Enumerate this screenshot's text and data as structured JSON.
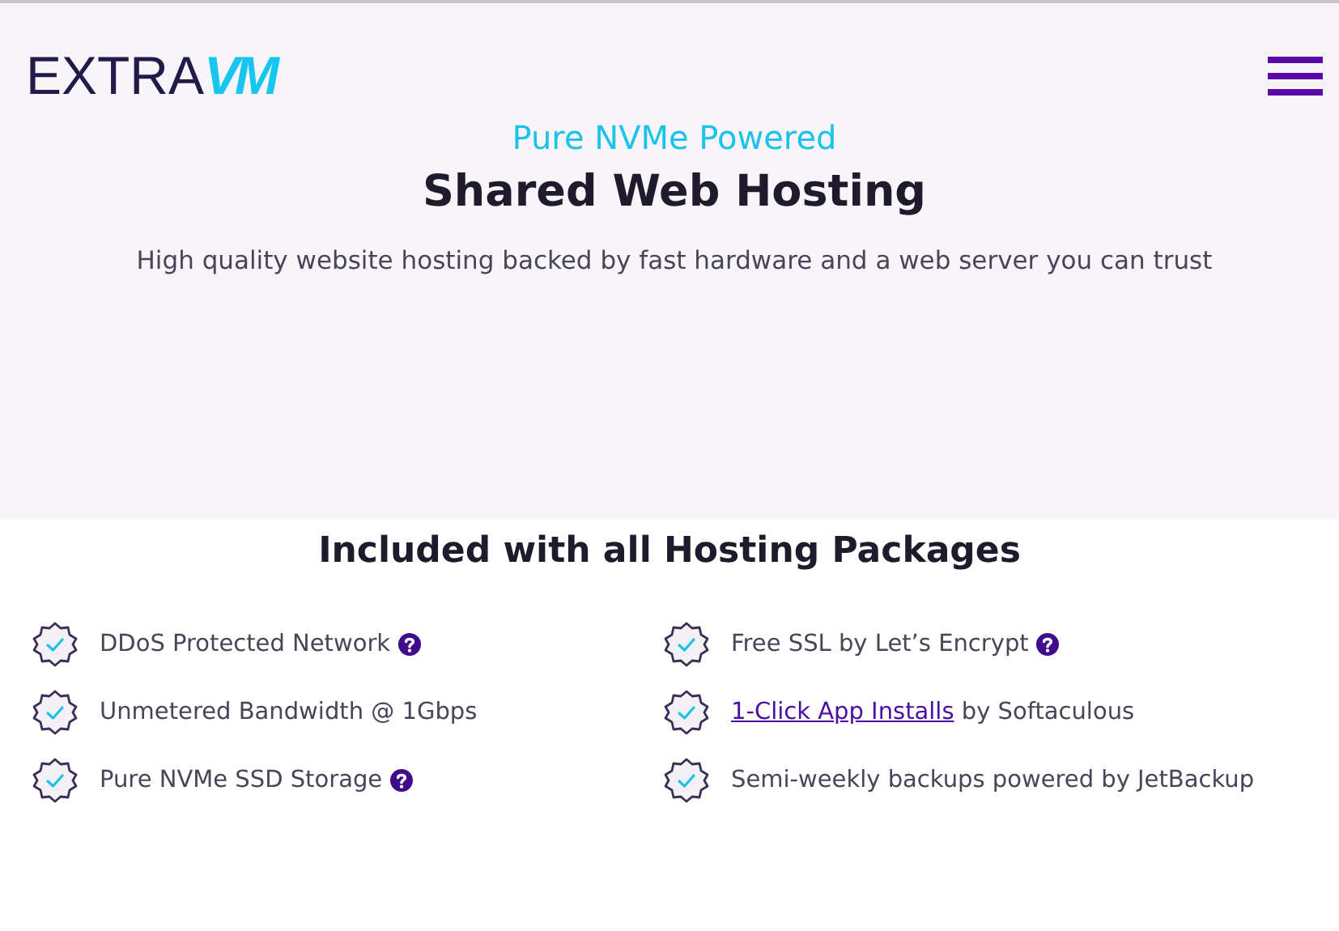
{
  "logo": {
    "text": "EXTRA",
    "mark": "VM"
  },
  "hero": {
    "eyebrow": "Pure NVMe Powered",
    "title": "Shared Web Hosting",
    "subtitle": "High quality website hosting backed by fast hardware and a web server you can trust"
  },
  "features": {
    "title": "Included with all Hosting Packages",
    "items": [
      {
        "text": "DDoS Protected Network",
        "help": true
      },
      {
        "text": "Free SSL by Let’s Encrypt",
        "help": true
      },
      {
        "text": "Unmetered Bandwidth @ 1Gbps",
        "help": false
      },
      {
        "link": "1-Click App Installs",
        "text": " by Softaculous",
        "help": false
      },
      {
        "text": "Pure NVMe SSD Storage",
        "help": true
      },
      {
        "text": "Semi-weekly backups powered by JetBackup",
        "help": false
      }
    ]
  }
}
